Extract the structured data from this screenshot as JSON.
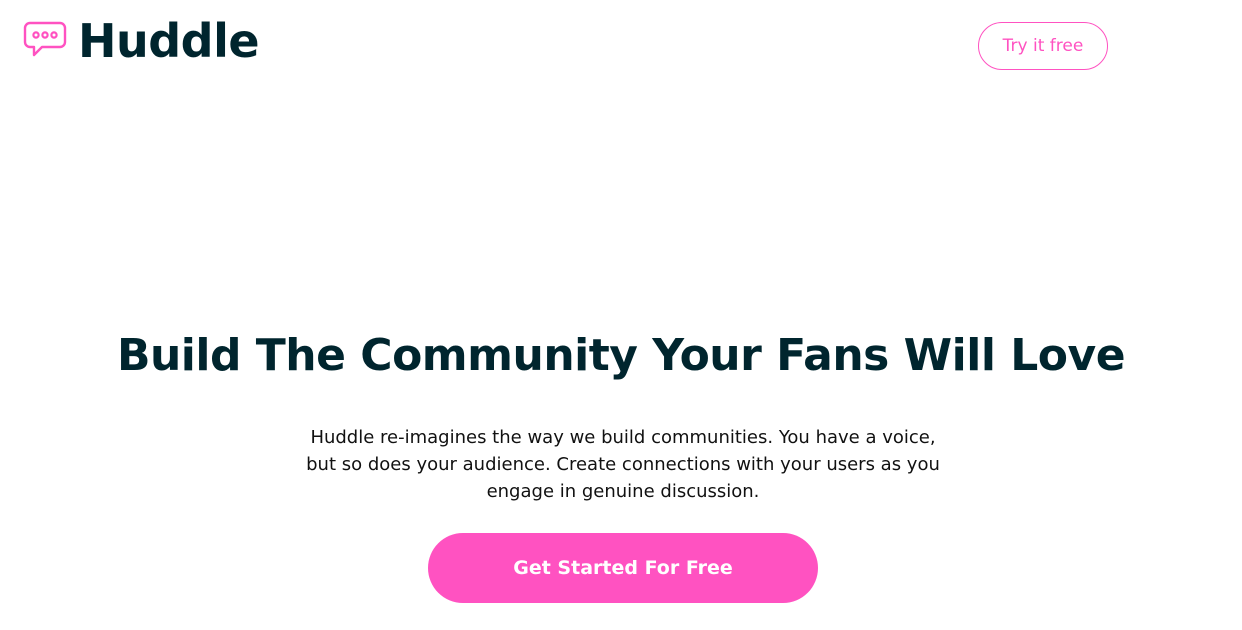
{
  "header": {
    "logo_text": "Huddle",
    "logo_icon": "chat-bubble-icon",
    "try_label": "Try it free"
  },
  "hero": {
    "headline": "Build The Community Your Fans Will Love",
    "subtext": "Huddle re-imagines the way we build communities. You have a voice, but so does your audience. Create connections with your users as you engage in genuine discussion.",
    "cta_label": "Get Started For Free"
  },
  "colors": {
    "brand_pink": "#ff52c1",
    "dark_text": "#00252e",
    "background": "#ffffff"
  }
}
